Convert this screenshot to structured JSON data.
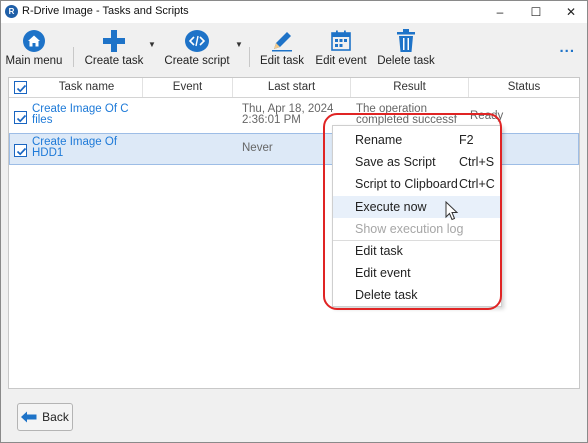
{
  "window": {
    "title": "R-Drive Image - Tasks and Scripts",
    "minimize": "–",
    "maximize": "☐",
    "close": "✕"
  },
  "toolbar": {
    "main_menu": "Main menu",
    "create_task": "Create task",
    "create_script": "Create script",
    "edit_task": "Edit task",
    "edit_event": "Edit event",
    "delete_task": "Delete task",
    "more": "..."
  },
  "table": {
    "columns": [
      "Task name",
      "Event",
      "Last start",
      "Result",
      "Status"
    ],
    "rows": [
      {
        "name_line1": "Create Image Of C",
        "name_line2": "files",
        "event": "",
        "last_start_line1": "Thu, Apr 18, 2024",
        "last_start_line2": "2:36:01 PM",
        "result_line1": "The operation",
        "result_line2": "completed successf",
        "status": "Ready",
        "checked": true
      },
      {
        "name_line1": "Create Image Of",
        "name_line2": "HDD1",
        "event": "",
        "last_start_line1": "Never",
        "last_start_line2": "",
        "result_line1": "",
        "result_line2": "",
        "status": "",
        "checked": true
      }
    ]
  },
  "context_menu": {
    "items": [
      {
        "label": "Rename",
        "shortcut": "F2"
      },
      {
        "label": "Save as Script",
        "shortcut": "Ctrl+S"
      },
      {
        "label": "Script to Clipboard",
        "shortcut": "Ctrl+C"
      },
      {
        "label": "Execute now",
        "shortcut": ""
      },
      {
        "label": "Show execution log",
        "shortcut": ""
      },
      {
        "label": "Edit task",
        "shortcut": ""
      },
      {
        "label": "Edit event",
        "shortcut": ""
      },
      {
        "label": "Delete task",
        "shortcut": ""
      }
    ]
  },
  "footer": {
    "back": "Back"
  },
  "colors": {
    "accent": "#1e73c8",
    "link": "#1e7ad8",
    "highlight_ring": "#e02424",
    "selected_row": "#dde9f7"
  },
  "icons": {
    "main_menu": "home-icon",
    "create_task": "plus-icon",
    "create_script": "code-icon",
    "edit_task": "pencil-icon",
    "edit_event": "calendar-icon",
    "delete_task": "trash-icon",
    "back": "arrow-left-icon"
  }
}
